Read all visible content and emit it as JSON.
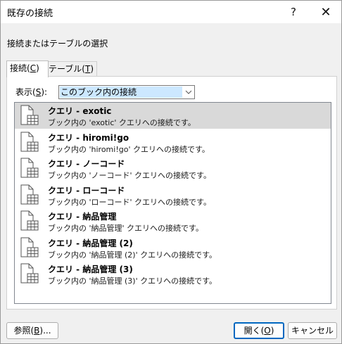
{
  "window": {
    "title": "既存の接続",
    "help_label": "?",
    "close_label": "✕"
  },
  "header": {
    "text": "接続またはテーブルの選択"
  },
  "tabs": [
    {
      "label": "接続(C)",
      "mnemonic": "C",
      "active": true
    },
    {
      "label": "テーブル(T)",
      "mnemonic": "T",
      "active": false
    }
  ],
  "filter": {
    "label": "表示(S):",
    "selected": "このブック内の接続"
  },
  "connections": [
    {
      "name": "クエリ - exotic",
      "description": "ブック内の 'exotic' クエリへの接続です。",
      "selected": true
    },
    {
      "name": "クエリ - hiromi!go",
      "description": "ブック内の 'hiromi!go' クエリへの接続です。",
      "selected": false
    },
    {
      "name": "クエリ - ノーコード",
      "description": "ブック内の 'ノーコード' クエリへの接続です。",
      "selected": false
    },
    {
      "name": "クエリ - ローコード",
      "description": "ブック内の 'ローコード' クエリへの接続です。",
      "selected": false
    },
    {
      "name": "クエリ - 納品管理",
      "description": "ブック内の '納品管理' クエリへの接続です。",
      "selected": false
    },
    {
      "name": "クエリ - 納品管理 (2)",
      "description": "ブック内の '納品管理 (2)' クエリへの接続です。",
      "selected": false
    },
    {
      "name": "クエリ - 納品管理 (3)",
      "description": "ブック内の '納品管理 (3)' クエリへの接続です。",
      "selected": false
    }
  ],
  "buttons": {
    "browse": "参照(B)...",
    "open": "開く(O)",
    "cancel": "キャンセル"
  },
  "colors": {
    "accent": "#0067c0",
    "selection": "#d9d9d9",
    "combo_highlight": "#cce8ff"
  }
}
